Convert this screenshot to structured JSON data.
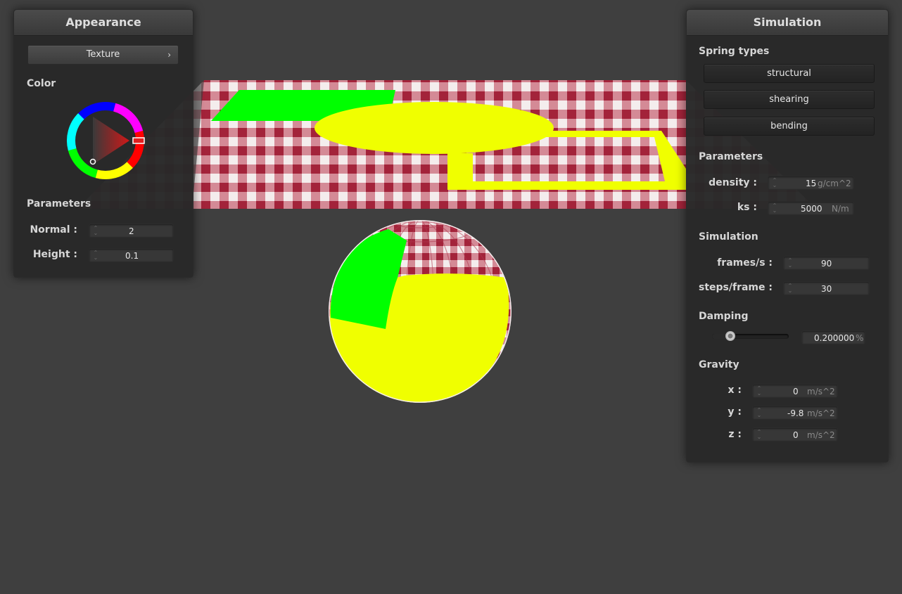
{
  "appearance": {
    "title": "Appearance",
    "texture_button": "Texture",
    "color_label": "Color",
    "params_label": "Parameters",
    "normal_label": "Normal :",
    "normal_value": "2",
    "height_label": "Height :",
    "height_value": "0.1"
  },
  "simulation": {
    "title": "Simulation",
    "spring_types_label": "Spring types",
    "structural": "structural",
    "shearing": "shearing",
    "bending": "bending",
    "params_label": "Parameters",
    "density_label": "density :",
    "density_value": "15",
    "density_unit": "g/cm^2",
    "ks_label": "ks :",
    "ks_value": "5000",
    "ks_unit": "N/m",
    "sim_label": "Simulation",
    "fps_label": "frames/s :",
    "fps_value": "90",
    "steps_label": "steps/frame :",
    "steps_value": "30",
    "damping_label": "Damping",
    "damping_value": "0.200000",
    "damping_unit": "%",
    "damping_fraction": 0.2,
    "gravity_label": "Gravity",
    "gx_label": "x :",
    "gx_value": "0",
    "gy_label": "y :",
    "gy_value": "-9.8",
    "gz_label": "z :",
    "gz_value": "0",
    "gravity_unit": "m/s^2"
  },
  "colors": {
    "background": "#3f3f3f",
    "cloth_red": "#a8243a",
    "highlight_yellow": "#f0ff00",
    "highlight_green": "#00ff00",
    "picker_red": "#e02020"
  }
}
